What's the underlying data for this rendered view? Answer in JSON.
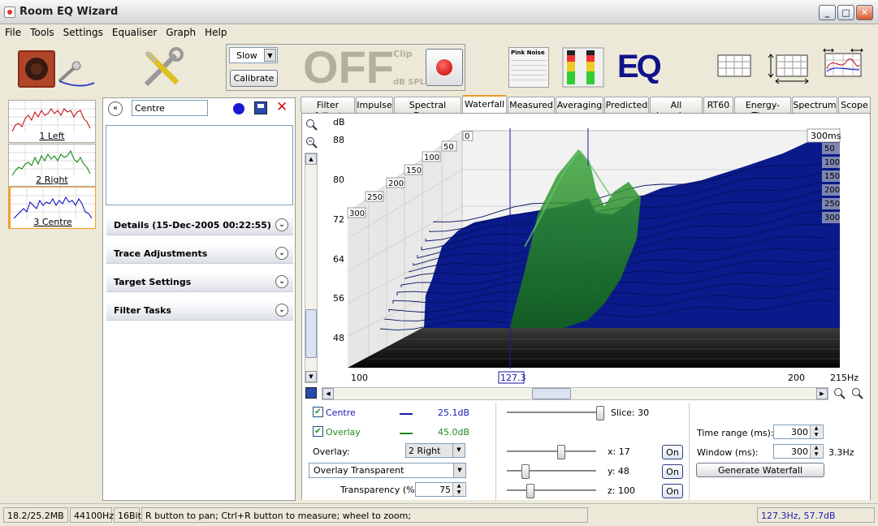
{
  "window": {
    "title": "Room EQ Wizard"
  },
  "menu": [
    "File",
    "Tools",
    "Settings",
    "Equaliser",
    "Graph",
    "Help"
  ],
  "toolbar": {
    "speed_value": "Slow",
    "calibrate_label": "Calibrate",
    "level_text": "OFF",
    "clip_label": "Clip",
    "unit_label": "dB SPL",
    "generator_label": "Pink Noise",
    "eq_label": "EQ"
  },
  "measurements": [
    {
      "label": "1 Left",
      "color": "#c00000"
    },
    {
      "label": "2 Right",
      "color": "#008000"
    },
    {
      "label": "3 Centre",
      "color": "#0000c0"
    }
  ],
  "panel": {
    "name_value": "Centre",
    "details_label": "Details  (15-Dec-2005 00:22:55)",
    "trace_label": "Trace Adjustments",
    "target_label": "Target Settings",
    "filter_label": "Filter Tasks"
  },
  "tabs": [
    "Filter Adjust",
    "Impulse",
    "Spectral Decay",
    "Waterfall",
    "Measured",
    "Averaging",
    "Predicted",
    "All Impulses",
    "RT60",
    "Energy-Time",
    "Spectrum",
    "Scope"
  ],
  "active_tab": "Waterfall",
  "graph": {
    "y_unit": "dB",
    "y_ticks": [
      "88",
      "80",
      "72",
      "64",
      "56",
      "48"
    ],
    "x_ticks": [
      "100",
      "200",
      "215Hz"
    ],
    "cursor_freq": "127.3",
    "time_unit_label": "300ms",
    "depth_ticks": [
      "0",
      "50",
      "100",
      "150",
      "200",
      "250",
      "300"
    ],
    "right_ticks": [
      "50",
      "100",
      "150",
      "200",
      "250",
      "300"
    ]
  },
  "controls": {
    "centre_label": "Centre",
    "centre_value": "25.1dB",
    "overlay_label": "Overlay",
    "overlay_value": "45.0dB",
    "overlay_select_label": "Overlay:",
    "overlay_select_value": "2 Right",
    "overlay_mode": "Overlay Transparent",
    "transparency_label": "Transparency (%)",
    "transparency_value": "75",
    "slice_label": "Slice: 30",
    "x_label": "x: 17",
    "y_label": "y: 48",
    "z_label": "z: 100",
    "on_label": "On",
    "time_range_label": "Time range (ms):",
    "time_range_value": "300",
    "window_label": "Window (ms):",
    "window_value": "300",
    "window_res": "3.3Hz",
    "generate_label": "Generate Waterfall"
  },
  "status": {
    "memory": "18.2/25.2MB",
    "rate": "44100Hz",
    "bits": "16Bit",
    "hint": "R button to pan; Ctrl+R button to measure; wheel to zoom;",
    "cursor": "127.3Hz,  57.7dB"
  }
}
